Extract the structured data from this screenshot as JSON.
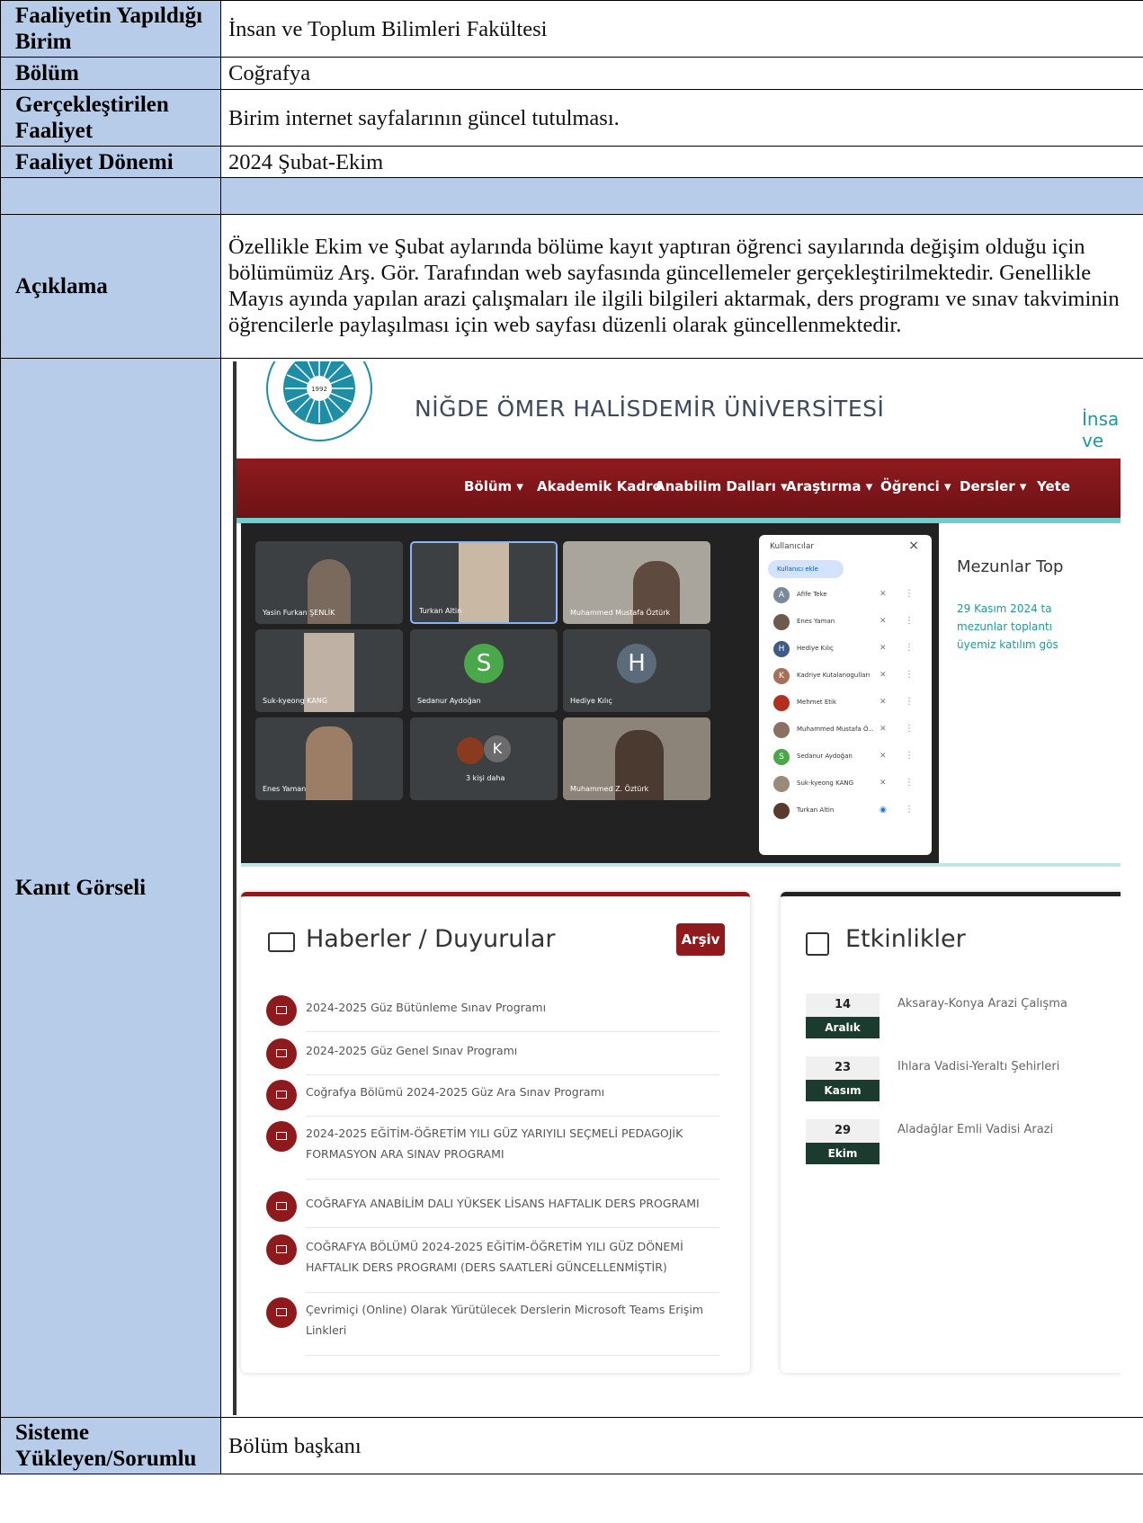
{
  "form": {
    "unit_label": "Faaliyetin Yapıldığı Birim",
    "unit_value": "İnsan ve Toplum Bilimleri Fakültesi",
    "dept_label": "Bölüm",
    "dept_value": "Coğrafya",
    "activity_label": "Gerçekleştirilen Faaliyet",
    "activity_value": "Birim internet sayfalarının güncel tutulması.",
    "period_label": "Faaliyet Dönemi",
    "period_value": "2024 Şubat-Ekim",
    "desc_label": "Açıklama",
    "desc_value": "Özellikle Ekim ve Şubat aylarında bölüme kayıt yaptıran öğrenci sayılarında değişim olduğu için bölümümüz Arş. Gör. Tarafından web sayfasında güncellemeler gerçekleştirilmektedir. Genellikle Mayıs ayında yapılan arazi çalışmaları ile ilgili bilgileri aktarmak, ders programı ve sınav takviminin öğrencilerle paylaşılması için web sayfası düzenli olarak güncellenmektedir.",
    "evidence_label": "Kanıt Görseli",
    "responsible_label": "Sisteme Yükleyen/Sorumlu",
    "responsible_value": "Bölüm başkanı"
  },
  "site": {
    "university": "NİĞDE ÖMER HALİSDEMİR ÜNİVERSİTESİ",
    "faculty_link": "İnsan ve",
    "logo_year": "1992",
    "nav": [
      "Bölüm ▾",
      "Akademik Kadro",
      "Anabilim Dalları ▾",
      "Araştırma ▾",
      "Öğrenci ▾",
      "Dersler ▾",
      "Yete"
    ],
    "meeting": {
      "tiles": [
        "Yasin Furkan ŞENLİK",
        "Turkan Altin",
        "Muhammed Mustafa Öztürk",
        "Suk-kyeong KANG",
        "Sedanur Aydoğan",
        "Hediye Kılıç",
        "Enes Yaman",
        "3 kişi daha",
        "Muhammed Z. Öztürk"
      ],
      "avatar_s": "S",
      "avatar_h": "H",
      "avatar_k": "K",
      "panel_title": "Kullanıcılar",
      "panel_close": "×",
      "add_user": "Kullanıcı ekle",
      "participants": [
        "Afife Teke",
        "Enes Yaman",
        "Hediye Kılıç",
        "Kadriye Kutalanogulları",
        "Mehmet Etik",
        "Muhammed Mustafa Ö...",
        "Sedanur Aydoğan",
        "Suk-kyeong KANG",
        "Turkan Altin"
      ]
    },
    "graduates": {
      "title": "Mezunlar Top",
      "lines": [
        "29 Kasım 2024 ta",
        "mezunlar toplantı",
        "üyemiz katılım gös"
      ]
    },
    "news": {
      "title": "Haberler / Duyurular",
      "archive": "Arşiv",
      "items": [
        "2024-2025 Güz Bütünleme Sınav Programı",
        "2024-2025 Güz Genel Sınav Programı",
        "Coğrafya Bölümü 2024-2025 Güz Ara Sınav Programı",
        "2024-2025 EĞİTİM-ÖĞRETİM YILI GÜZ YARIYILI SEÇMELİ PEDAGOJİK FORMASYON ARA SINAV PROGRAMI",
        "COĞRAFYA ANABİLİM DALI YÜKSEK LİSANS HAFTALIK DERS PROGRAMI",
        "COĞRAFYA BÖLÜMÜ 2024-2025 EĞİTİM-ÖĞRETİM YILI GÜZ DÖNEMİ HAFTALIK DERS PROGRAMI (DERS SAATLERİ GÜNCELLENMİŞTİR)",
        "Çevrimiçi (Online) Olarak Yürütülecek Derslerin Microsoft Teams Erişim Linkleri"
      ]
    },
    "events": {
      "title": "Etkinlikler",
      "items": [
        {
          "day": "14",
          "month": "Aralık",
          "text": "Aksaray-Konya Arazi Çalışma"
        },
        {
          "day": "23",
          "month": "Kasım",
          "text": "Ihlara Vadisi-Yeraltı Şehirleri"
        },
        {
          "day": "29",
          "month": "Ekim",
          "text": "Aladağlar Emli Vadisi Arazi"
        }
      ]
    }
  }
}
